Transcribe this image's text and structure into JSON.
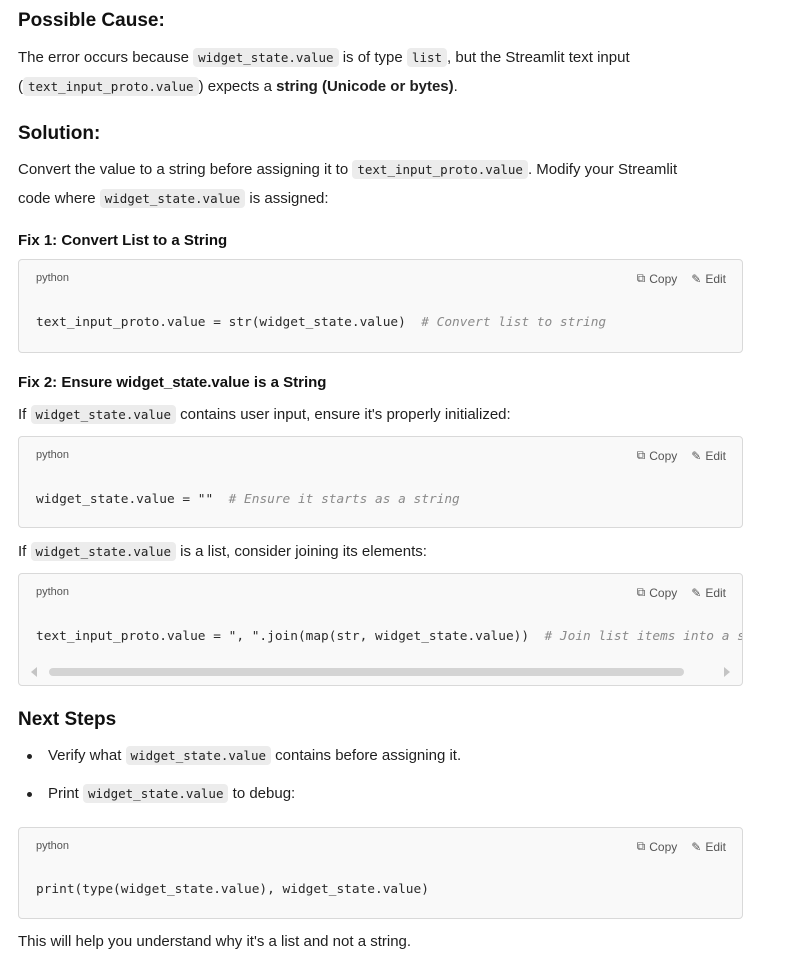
{
  "possible_cause": {
    "heading": "Possible Cause:",
    "line1_a": "The error occurs because ",
    "line1_code1": "widget_state.value",
    "line1_b": " is of type ",
    "line1_code2": "list",
    "line1_c": ", but the Streamlit text input",
    "line2_a": "(",
    "line2_code": "text_input_proto.value",
    "line2_b": ") expects a ",
    "line2_bold": "string (Unicode or bytes)",
    "line2_c": "."
  },
  "solution": {
    "heading": "Solution:",
    "line1_a": "Convert the value to a string before assigning it to ",
    "line1_code": "text_input_proto.value",
    "line1_b": ". Modify your Streamlit",
    "line2_a": "code where ",
    "line2_code": "widget_state.value",
    "line2_b": " is assigned:"
  },
  "fix1": {
    "heading": "Fix 1: Convert List to a String",
    "block": {
      "lang": "python",
      "copy": "Copy",
      "edit": "Edit",
      "code": "text_input_proto.value = str(widget_state.value)  ",
      "comment": "# Convert list to string"
    }
  },
  "fix2": {
    "heading": "Fix 2: Ensure widget_state.value is a String",
    "para1_a": "If ",
    "para1_code": "widget_state.value",
    "para1_b": " contains user input, ensure it's properly initialized:",
    "block1": {
      "lang": "python",
      "copy": "Copy",
      "edit": "Edit",
      "code": "widget_state.value = \"\"  ",
      "comment": "# Ensure it starts as a string"
    },
    "para2_a": "If ",
    "para2_code": "widget_state.value",
    "para2_b": " is a list, consider joining its elements:",
    "block2": {
      "lang": "python",
      "copy": "Copy",
      "edit": "Edit",
      "code": "text_input_proto.value = \", \".join(map(str, widget_state.value))  ",
      "comment": "# Join list items into a st"
    }
  },
  "next_steps": {
    "heading": "Next Steps",
    "item1_a": "Verify what ",
    "item1_code": "widget_state.value",
    "item1_b": " contains before assigning it.",
    "item2_a": "Print ",
    "item2_code": "widget_state.value",
    "item2_b": " to debug:",
    "block": {
      "lang": "python",
      "copy": "Copy",
      "edit": "Edit",
      "code": "print(type(widget_state.value), widget_state.value)"
    },
    "closing": "This will help you understand why it's a list and not a string."
  }
}
